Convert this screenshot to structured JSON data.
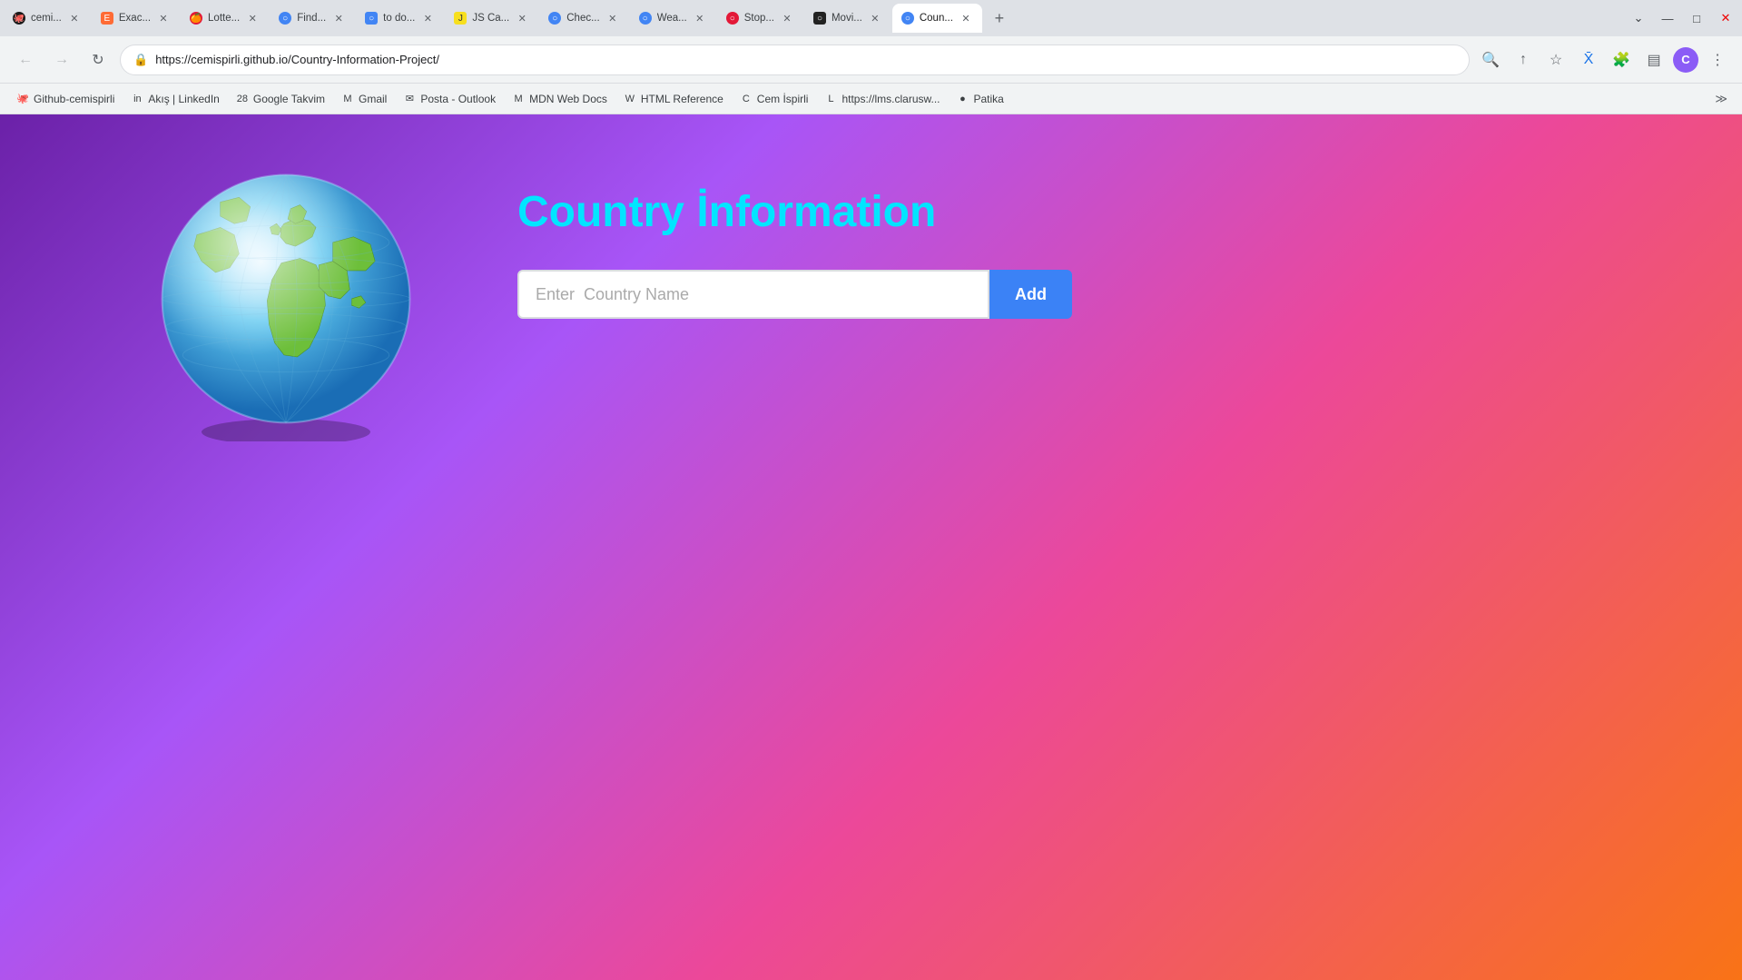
{
  "browser": {
    "tabs": [
      {
        "id": "tab-cemi",
        "label": "cemi...",
        "favicon": "🐙",
        "favcls": "fav-github",
        "active": false
      },
      {
        "id": "tab-exact",
        "label": "Exac...",
        "favicon": "E",
        "favcls": "fav-exact",
        "active": false
      },
      {
        "id": "tab-lotte",
        "label": "Lotte...",
        "favicon": "🍊",
        "favcls": "fav-lotte",
        "active": false
      },
      {
        "id": "tab-find",
        "label": "Find...",
        "favicon": "○",
        "favcls": "fav-find",
        "active": false
      },
      {
        "id": "tab-todo",
        "label": "to do...",
        "favicon": "○",
        "favcls": "fav-todo",
        "active": false
      },
      {
        "id": "tab-js",
        "label": "JS Ca...",
        "favicon": "J",
        "favcls": "fav-js",
        "active": false
      },
      {
        "id": "tab-check",
        "label": "Chec...",
        "favicon": "○",
        "favcls": "fav-check",
        "active": false
      },
      {
        "id": "tab-weather",
        "label": "Wea...",
        "favicon": "○",
        "favcls": "fav-weather",
        "active": false
      },
      {
        "id": "tab-stop",
        "label": "Stop...",
        "favicon": "○",
        "favcls": "fav-stop",
        "active": false
      },
      {
        "id": "tab-movie",
        "label": "Movi...",
        "favicon": "○",
        "favcls": "fav-movie",
        "active": false
      },
      {
        "id": "tab-country",
        "label": "Coun...",
        "favicon": "○",
        "favcls": "fav-country",
        "active": true
      }
    ],
    "url": "https://cemispirli.github.io/Country-Information-Project/",
    "profile_letter": "C"
  },
  "bookmarks": [
    {
      "label": "Github-cemispirli",
      "favicon": "🐙"
    },
    {
      "label": "Akış | LinkedIn",
      "favicon": "in"
    },
    {
      "label": "Google Takvim",
      "favicon": "28"
    },
    {
      "label": "Gmail",
      "favicon": "M"
    },
    {
      "label": "Posta - Outlook",
      "favicon": "✉"
    },
    {
      "label": "MDN Web Docs",
      "favicon": "M"
    },
    {
      "label": "HTML Reference",
      "favicon": "W"
    },
    {
      "label": "Cem İspirli",
      "favicon": "C"
    },
    {
      "label": "https://lms.clarusw...",
      "favicon": "L"
    },
    {
      "label": "Patika",
      "favicon": "●"
    }
  ],
  "page": {
    "title": "Country İnformation",
    "input_placeholder": "Enter  Country Name",
    "add_button": "Add"
  }
}
